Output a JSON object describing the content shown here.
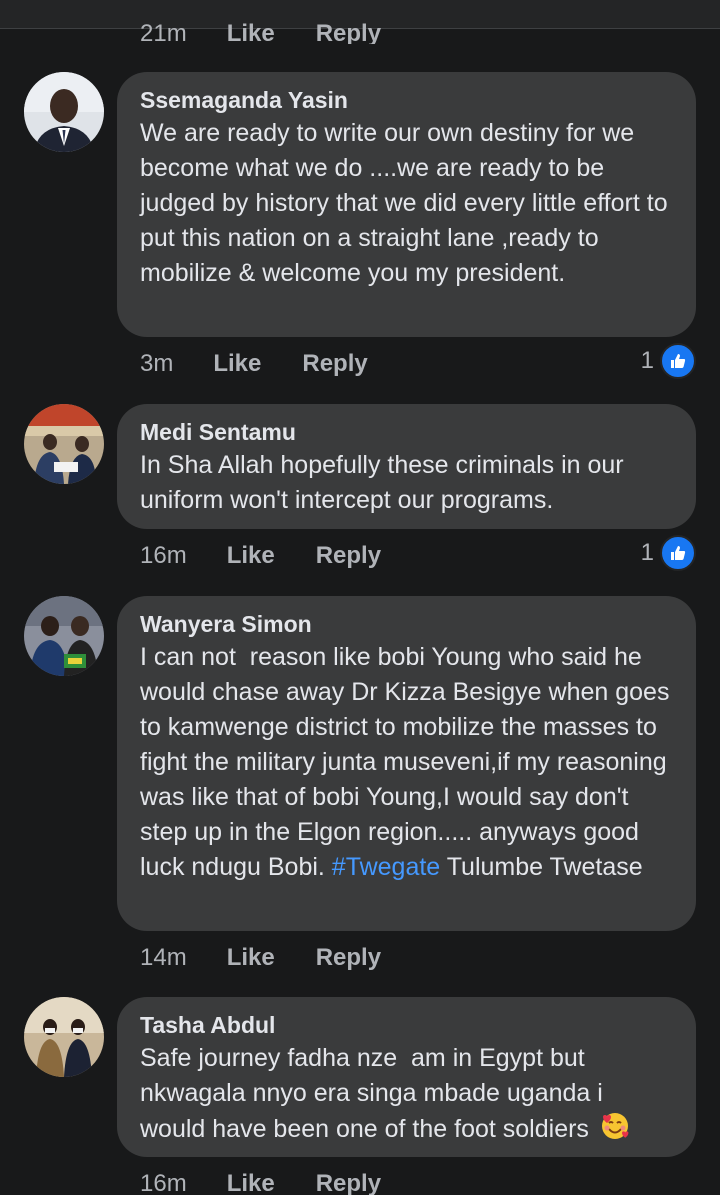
{
  "previous_comment": {
    "time": "21m",
    "like_label": "Like",
    "reply_label": "Reply"
  },
  "comments": [
    {
      "author": "Ssemaganda Yasin",
      "text": "We are ready to write our own destiny for we become what we do ....we are ready to be judged by history that we did every little effort to put this nation on a straight lane ,ready to mobilize & welcome you my president.",
      "time": "3m",
      "like_label": "Like",
      "reply_label": "Reply",
      "reaction_count": "1",
      "reaction_icon": "thumbs-up-icon"
    },
    {
      "author": "Medi Sentamu",
      "text": "In Sha Allah hopefully these criminals in our uniform won't intercept our programs.",
      "time": "16m",
      "like_label": "Like",
      "reply_label": "Reply",
      "reaction_count": "1",
      "reaction_icon": "thumbs-up-icon"
    },
    {
      "author": "Wanyera Simon",
      "text_before_hashtag": "I can not  reason like bobi Young who said he would chase away Dr Kizza Besigye when goes to kamwenge district to mobilize the masses to fight the military junta museveni,if my reasoning was like that of bobi Young,I would say don't step up in the Elgon region..... anyways good luck ndugu Bobi. ",
      "hashtag": "#Twegate",
      "text_after_hashtag": " Tulumbe Twetase",
      "time": "14m",
      "like_label": "Like",
      "reply_label": "Reply"
    },
    {
      "author": "Tasha Abdul",
      "text": "Safe journey fadha nze  am in Egypt but nkwagala nnyo era singa mbade uganda i would have been one of the foot soldiers ",
      "emoji": "smiling-face-with-hearts-icon",
      "time": "16m",
      "like_label": "Like",
      "reply_label": "Reply"
    }
  ],
  "colors": {
    "background": "#18191a",
    "bubble": "#3a3b3c",
    "text": "#e4e6eb",
    "secondary_text": "#b0b3b8",
    "link": "#4599ff",
    "like_blue": "#1877f2"
  }
}
